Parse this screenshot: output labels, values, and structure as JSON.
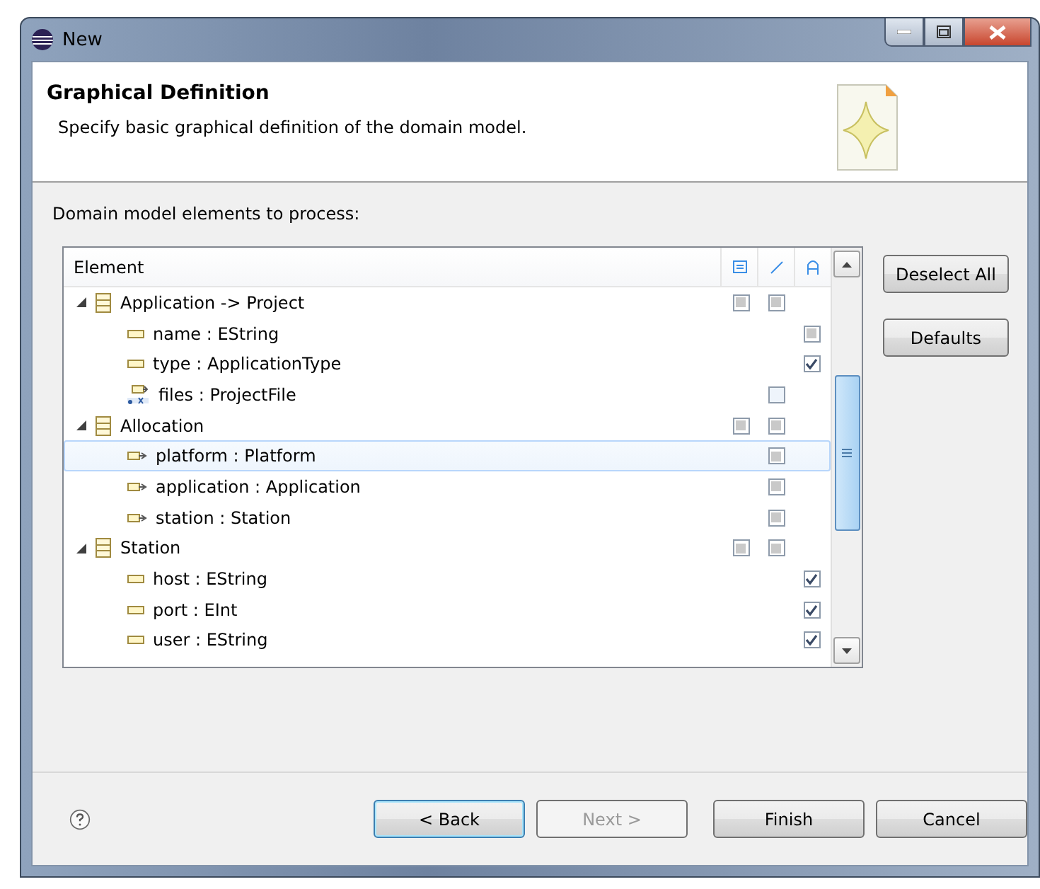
{
  "window": {
    "title": "New"
  },
  "header": {
    "title": "Graphical Definition",
    "description": "Specify basic graphical definition of the domain model."
  },
  "prompt": "Domain model elements to process:",
  "tree": {
    "column": "Element",
    "rows": [
      {
        "kind": "class",
        "label": "Application -> Project",
        "expanded": true,
        "selected": false,
        "checks": {
          "node": {
            "checked": true,
            "grayed": true
          },
          "link": {
            "checked": true,
            "grayed": true
          }
        },
        "children": [
          {
            "kind": "attribute",
            "label": "name : EString",
            "selected": false,
            "checks": {
              "label": {
                "checked": true,
                "grayed": true
              }
            }
          },
          {
            "kind": "attribute",
            "label": "type : ApplicationType",
            "selected": false,
            "checks": {
              "label": {
                "checked": true,
                "grayed": false
              }
            }
          },
          {
            "kind": "many",
            "label": "files : ProjectFile",
            "selected": false,
            "checks": {
              "link": {
                "checked": false,
                "grayed": false
              }
            }
          }
        ]
      },
      {
        "kind": "class",
        "label": "Allocation",
        "expanded": true,
        "selected": false,
        "checks": {
          "node": {
            "checked": true,
            "grayed": true
          },
          "link": {
            "checked": true,
            "grayed": true
          }
        },
        "children": [
          {
            "kind": "reference",
            "label": "platform : Platform",
            "selected": true,
            "checks": {
              "link": {
                "checked": true,
                "grayed": true
              }
            }
          },
          {
            "kind": "reference",
            "label": "application : Application",
            "selected": false,
            "checks": {
              "link": {
                "checked": true,
                "grayed": true
              }
            }
          },
          {
            "kind": "reference",
            "label": "station : Station",
            "selected": false,
            "checks": {
              "link": {
                "checked": true,
                "grayed": true
              }
            }
          }
        ]
      },
      {
        "kind": "class",
        "label": "Station",
        "expanded": true,
        "selected": false,
        "checks": {
          "node": {
            "checked": true,
            "grayed": true
          },
          "link": {
            "checked": true,
            "grayed": true
          }
        },
        "children": [
          {
            "kind": "attribute",
            "label": "host : EString",
            "selected": false,
            "checks": {
              "label": {
                "checked": true,
                "grayed": false
              }
            }
          },
          {
            "kind": "attribute",
            "label": "port : EInt",
            "selected": false,
            "checks": {
              "label": {
                "checked": true,
                "grayed": false
              }
            }
          },
          {
            "kind": "attribute",
            "label": "user : EString",
            "selected": false,
            "checks": {
              "label": {
                "checked": true,
                "grayed": false
              }
            }
          }
        ]
      }
    ]
  },
  "side_buttons": [
    "Deselect All",
    "Defaults"
  ],
  "footer": {
    "buttons": [
      {
        "label": "< Back",
        "disabled": false,
        "default": true
      },
      {
        "label": "Next >",
        "disabled": true,
        "default": false
      },
      {
        "label": "Finish",
        "disabled": false,
        "default": false
      },
      {
        "label": "Cancel",
        "disabled": false,
        "default": false
      }
    ]
  }
}
